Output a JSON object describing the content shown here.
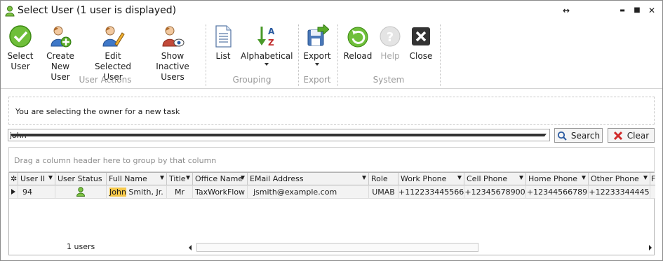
{
  "window": {
    "title": "Select User (1 user is displayed)",
    "controls": {
      "restore": "↔",
      "minimize": "▬",
      "maximize": "■",
      "close": "✕"
    }
  },
  "ribbon": {
    "buttons": {
      "select_user": "Select\nUser",
      "create_new_user": "Create\nNew User",
      "edit_selected_user": "Edit Selected\nUser",
      "show_inactive_users": "Show\nInactive Users",
      "list": "List",
      "alphabetical": "Alphabetical",
      "export": "Export",
      "reload": "Reload",
      "help": "Help",
      "close": "Close"
    },
    "groups": {
      "user_actions": "User Actions",
      "grouping": "Grouping",
      "export": "Export",
      "system": "System"
    },
    "alpha_icon": {
      "a": "A",
      "z": "Z"
    }
  },
  "info": {
    "message": "You are selecting the owner for a new task"
  },
  "search": {
    "value": "john",
    "search_label": "Search",
    "clear_label": "Clear"
  },
  "group_panel": {
    "hint": "Drag a column header here to group by that column"
  },
  "grid": {
    "columns": [
      "User II",
      "User Status",
      "Full Name",
      "Title",
      "Office Name",
      "EMail Address",
      "Role",
      "Work Phone",
      "Cell Phone",
      "Home Phone",
      "Other Phone",
      "Fa"
    ],
    "rows": [
      {
        "user_id": "94",
        "full_name_highlight": "John",
        "full_name_rest": " Smith, Jr.",
        "title": "Mr",
        "office": "TaxWorkFlow",
        "email": "jsmith@example.com",
        "role": "UMAB",
        "work_phone": "+112233445566",
        "cell_phone": "+12345678900",
        "home_phone": "+12344566789",
        "other_phone": "+12233344445"
      }
    ],
    "footer_count": "1 users"
  },
  "colors": {
    "highlight": "#f6c84a",
    "user_green": "#5aa02c"
  }
}
